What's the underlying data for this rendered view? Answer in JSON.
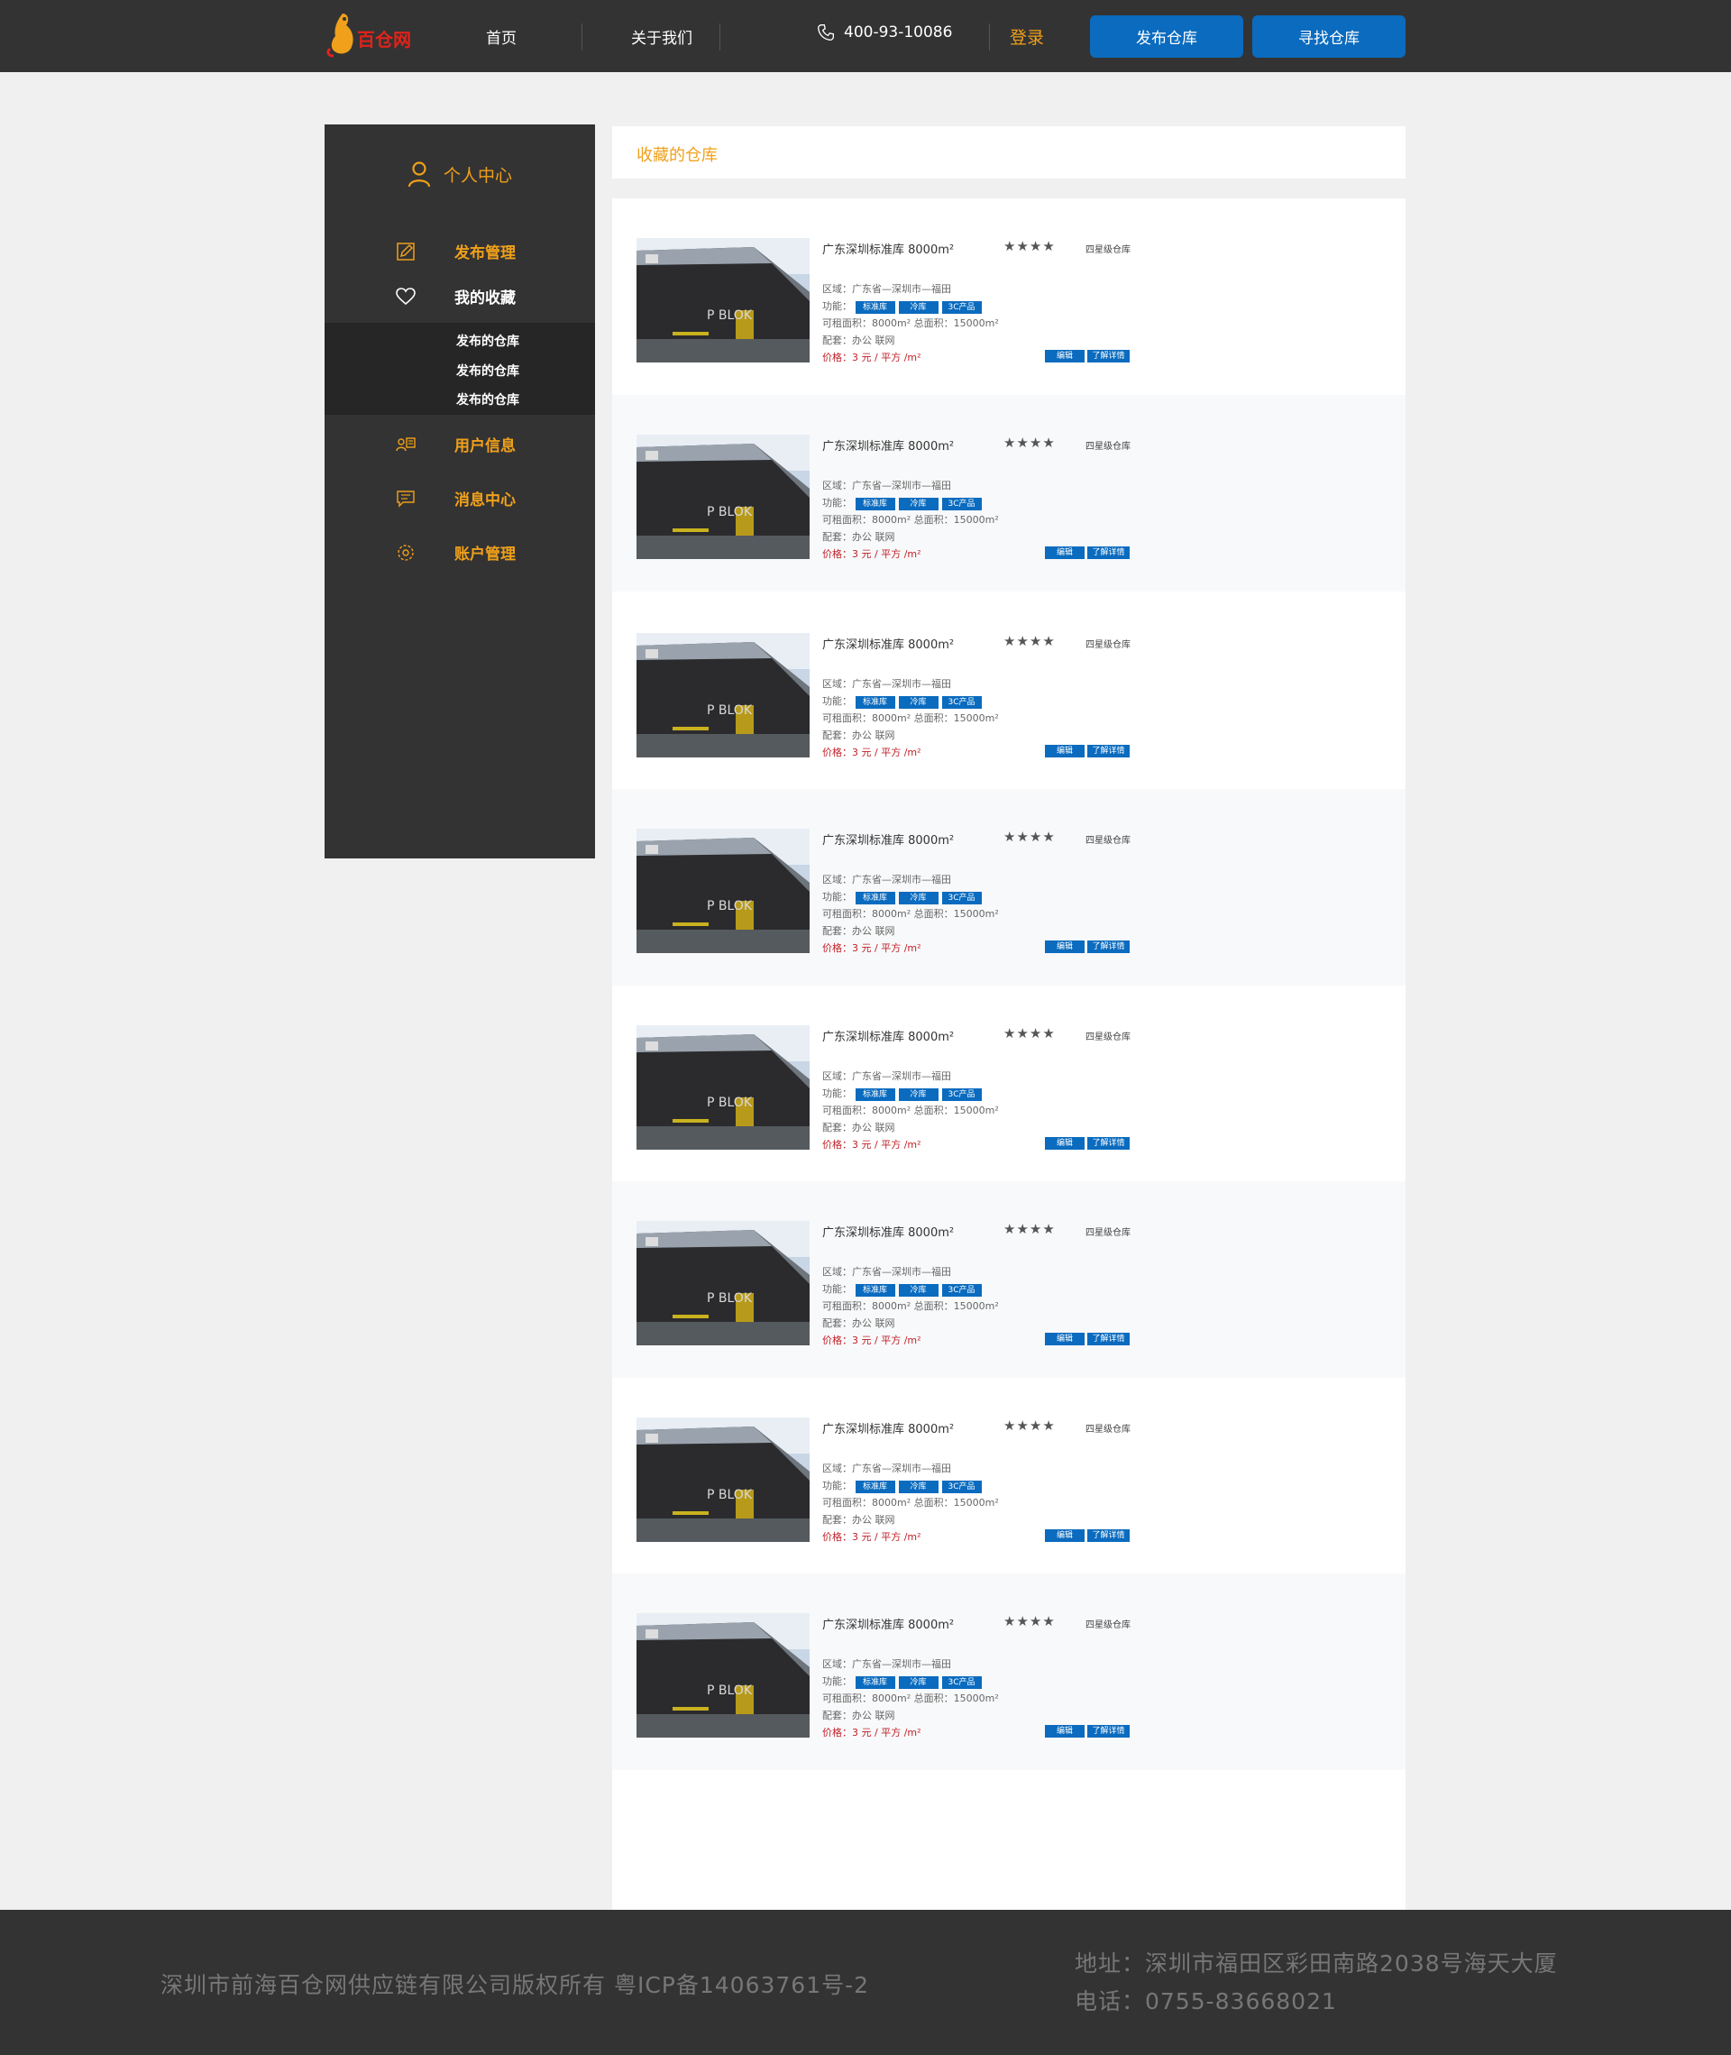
{
  "header": {
    "logo_text": "百仓网",
    "nav": [
      "首页",
      "关于我们"
    ],
    "phone": "400-93-10086",
    "login": "登录",
    "publish_btn": "发布仓库",
    "find_btn": "寻找仓库"
  },
  "sidebar": {
    "title": "个人中心",
    "items": [
      {
        "label": "发布管理",
        "icon": "edit-icon"
      },
      {
        "label": "我的收藏",
        "icon": "heart-icon"
      },
      {
        "label": "用户信息",
        "icon": "user-card-icon"
      },
      {
        "label": "消息中心",
        "icon": "message-icon"
      },
      {
        "label": "账户管理",
        "icon": "gear-icon"
      }
    ],
    "sub_items": [
      "发布的仓库",
      "发布的仓库",
      "发布的仓库"
    ]
  },
  "main": {
    "title": "收藏的仓库",
    "card": {
      "title": "广东深圳标准库 8000m²",
      "stars": "★★★★",
      "level": "四星级仓库",
      "region": "区域：广东省—深圳市—福田",
      "function_label": "功能：",
      "tags": [
        "标准库",
        "冷库",
        "3C产品"
      ],
      "area": "可租面积：8000m² 总面积：15000m²",
      "facilities": "配套：办公  联网",
      "price": "价格：3 元 / 平方 /m²",
      "edit_btn": "编辑",
      "detail_btn": "了解详情",
      "photo_text": "P BLOK"
    }
  },
  "footer": {
    "copyright": "深圳市前海百仓网供应链有限公司版权所有   粤ICP备14063761号-2",
    "address": "地址：深圳市福田区彩田南路2038号海天大厦",
    "tel": "电话：0755-83668021"
  },
  "colors": {
    "dark": "#333333",
    "accent_orange": "#f0a01a",
    "brand_blue": "#0a6bbf",
    "price_red": "#c0222a"
  }
}
